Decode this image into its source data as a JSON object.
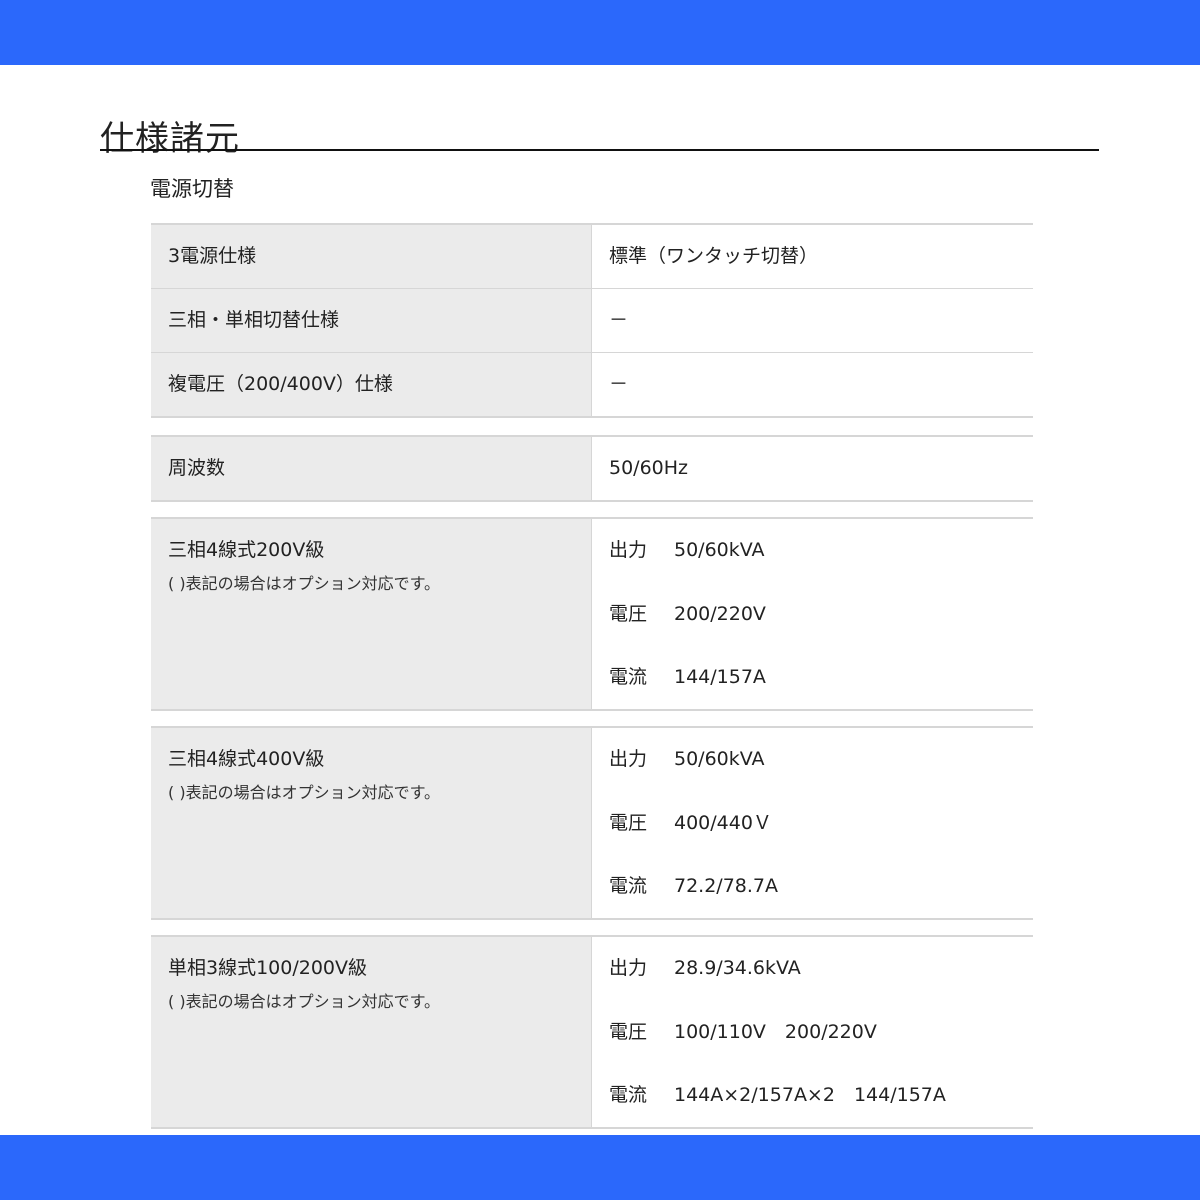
{
  "page_title": "仕様諸元",
  "section_title": "電源切替",
  "table1": [
    {
      "label": "3電源仕様",
      "value": "標準（ワンタッチ切替）"
    },
    {
      "label": "三相・単相切替仕様",
      "value": "－"
    },
    {
      "label": "複電圧（200/400V）仕様",
      "value": "－"
    }
  ],
  "table2": [
    {
      "label": "周波数",
      "value": "50/60Hz"
    }
  ],
  "table3": {
    "label": "三相4線式200V級",
    "note": "( )表記の場合はオプション対応です。",
    "lines": [
      {
        "key": "出力",
        "value": "50/60kVA"
      },
      {
        "key": "電圧",
        "value": "200/220V"
      },
      {
        "key": "電流",
        "value": "144/157A"
      }
    ]
  },
  "table4": {
    "label": "三相4線式400V級",
    "note": "( )表記の場合はオプション対応です。",
    "lines": [
      {
        "key": "出力",
        "value": "50/60kVA"
      },
      {
        "key": "電圧",
        "value": "400/440Ｖ"
      },
      {
        "key": "電流",
        "value": "72.2/78.7A"
      }
    ]
  },
  "table5": {
    "label": "単相3線式100/200V級",
    "note": "( )表記の場合はオプション対応です。",
    "lines": [
      {
        "key": "出力",
        "value": "28.9/34.6kVA"
      },
      {
        "key": "電圧",
        "value": "100/110V　200/220V"
      },
      {
        "key": "電流",
        "value": "144A×2/157A×2　144/157A"
      }
    ]
  },
  "colors": {
    "band": "#2b68fb",
    "label_bg": "#ebebeb",
    "rule": "#d6d6d6"
  }
}
